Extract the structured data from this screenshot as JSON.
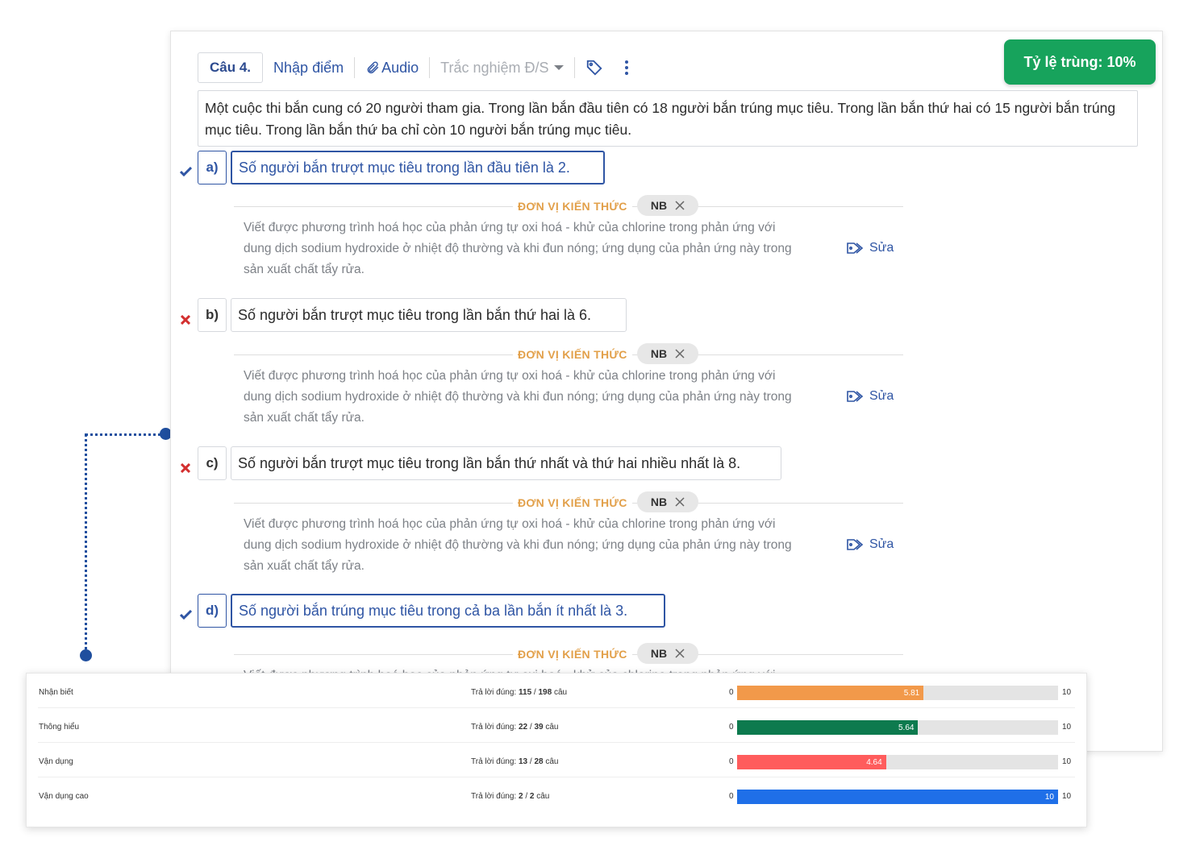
{
  "question": {
    "number_label": "Câu 4.",
    "enter_score_label": "Nhập điểm",
    "audio_label": "Audio",
    "type_label": "Trắc nghiệm Đ/S",
    "duplicate_ratio_label": "Tỷ lệ trùng: 10%",
    "text": "Một cuộc thi bắn cung có 20 người tham gia. Trong lần bắn đầu tiên có 18 người bắn trúng mục tiêu. Trong lần bắn thứ hai có 15 người bắn trúng mục tiêu. Trong lần bắn thứ ba chỉ còn 10 người bắn trúng mục tiêu."
  },
  "options": [
    {
      "letter": "a)",
      "text": "Số người bắn trượt mục tiêu trong lần đầu tiên là 2.",
      "correct": true
    },
    {
      "letter": "b)",
      "text": "Số người bắn trượt mục tiêu trong lần bắn thứ hai là 6.",
      "correct": false
    },
    {
      "letter": "c)",
      "text": "Số người bắn trượt mục tiêu trong lần bắn thứ nhất và thứ hai nhiều nhất là 8.",
      "correct": false
    },
    {
      "letter": "d)",
      "text": "Số người bắn trúng mục tiêu trong cả ba lần bắn ít nhất là 3.",
      "correct": true
    }
  ],
  "knowledge": {
    "label": "ĐƠN VỊ KIẾN THỨC",
    "chip": "NB",
    "description_lines": [
      "Viết được phương trình hoá học của phản ứng tự oxi hoá - khử của chlorine trong phản ứng với",
      "dung dịch sodium hydroxide ở nhiệt độ thường và khi đun nóng; ứng dụng của phản ứng này trong",
      "sản xuất chất tẩy rửa."
    ],
    "edit_label": "Sửa"
  },
  "stats": {
    "answers_prefix": "Trả lời đúng:",
    "unit": "câu",
    "min_label": "0",
    "max_label": "10",
    "rows": [
      {
        "level": "Nhận biết",
        "correct": "115",
        "total": "198",
        "score": 5.81,
        "score_label": "5.81",
        "color": "#f2994a"
      },
      {
        "level": "Thông hiểu",
        "correct": "22",
        "total": "39",
        "score": 5.64,
        "score_label": "5.64",
        "color": "#0d7a4e"
      },
      {
        "level": "Vận dụng",
        "correct": "13",
        "total": "28",
        "score": 4.64,
        "score_label": "4.64",
        "color": "#ff5c5c"
      },
      {
        "level": "Vận dụng cao",
        "correct": "2",
        "total": "2",
        "score": 10,
        "score_label": "10",
        "color": "#1f6fe8"
      }
    ]
  }
}
